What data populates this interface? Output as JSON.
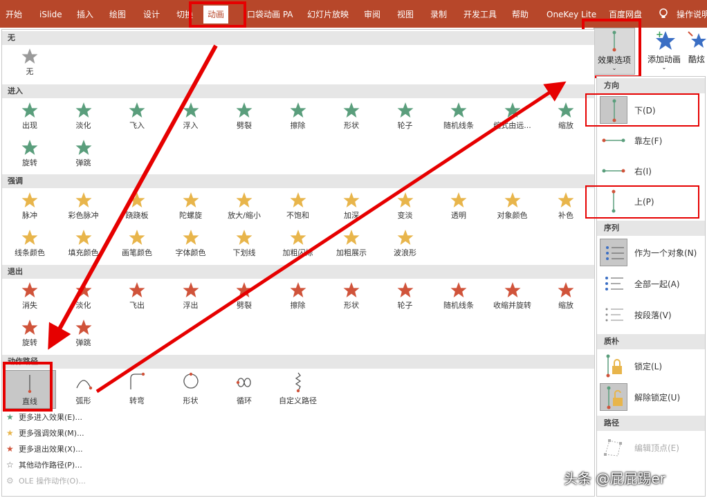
{
  "ribbon": {
    "tabs": [
      "开始",
      "iSlide",
      "插入",
      "绘图",
      "设计",
      "切换",
      "动画",
      "口袋动画 PA",
      "幻灯片放映",
      "审阅",
      "视图",
      "录制",
      "开发工具",
      "帮助",
      "OneKey Lite",
      "百度网盘"
    ],
    "active_tab": "动画",
    "tell_me": "操作说明",
    "effect_options_label": "效果选项",
    "add_animation_label": "添加动画",
    "cool_label": "酷炫"
  },
  "gallery": {
    "none": {
      "header": "无",
      "items": [
        "无"
      ]
    },
    "entrance": {
      "header": "进入",
      "color": "#5a9e7c",
      "items": [
        "出现",
        "淡化",
        "飞入",
        "浮入",
        "劈裂",
        "擦除",
        "形状",
        "轮子",
        "随机线条",
        "缩式由远...",
        "缩放",
        "旋转",
        "弹跳"
      ]
    },
    "emphasis": {
      "header": "强调",
      "color": "#e8b54b",
      "items": [
        "脉冲",
        "彩色脉冲",
        "跷跷板",
        "陀螺旋",
        "放大/缩小",
        "不饱和",
        "加深",
        "变淡",
        "透明",
        "对象颜色",
        "补色",
        "线条颜色",
        "填充颜色",
        "画笔颜色",
        "字体颜色",
        "下划线",
        "加粗闪烁",
        "加粗展示",
        "波浪形"
      ]
    },
    "exit": {
      "header": "退出",
      "color": "#d0533a",
      "items": [
        "消失",
        "淡化",
        "飞出",
        "浮出",
        "劈裂",
        "擦除",
        "形状",
        "轮子",
        "随机线条",
        "收缩并旋转",
        "缩放",
        "旋转",
        "弹跳"
      ]
    },
    "motion_paths": {
      "header": "动作路径",
      "items": [
        "直线",
        "弧形",
        "转弯",
        "形状",
        "循环",
        "自定义路径"
      ]
    },
    "more": [
      {
        "icon": "★",
        "label": "更多进入效果(E)...",
        "color": "#5a9e7c"
      },
      {
        "icon": "★",
        "label": "更多强调效果(M)...",
        "color": "#e8b54b"
      },
      {
        "icon": "★",
        "label": "更多退出效果(X)...",
        "color": "#d0533a"
      },
      {
        "icon": "☆",
        "label": "其他动作路径(P)...",
        "color": "#666666"
      },
      {
        "icon": "⚙",
        "label": "OLE 操作动作(O)...",
        "color": "#bbbbbb"
      }
    ]
  },
  "effect_options": {
    "direction": {
      "header": "方向",
      "items": [
        "下(D)",
        "靠左(F)",
        "右(I)",
        "上(P)"
      ]
    },
    "sequence": {
      "header": "序列",
      "items": [
        "作为一个对象(N)",
        "全部一起(A)",
        "按段落(V)"
      ]
    },
    "anchor": {
      "header": "质朴",
      "items": [
        "锁定(L)",
        "解除锁定(U)"
      ]
    },
    "path": {
      "header": "路径",
      "items": [
        "编辑顶点(E)"
      ]
    }
  },
  "watermark": "头条 @屁屁踢er",
  "colors": {
    "ribbon": "#b7472a",
    "highlight": "#e60000",
    "path_line": "#5a9e7c",
    "path_end": "#d0533a"
  }
}
